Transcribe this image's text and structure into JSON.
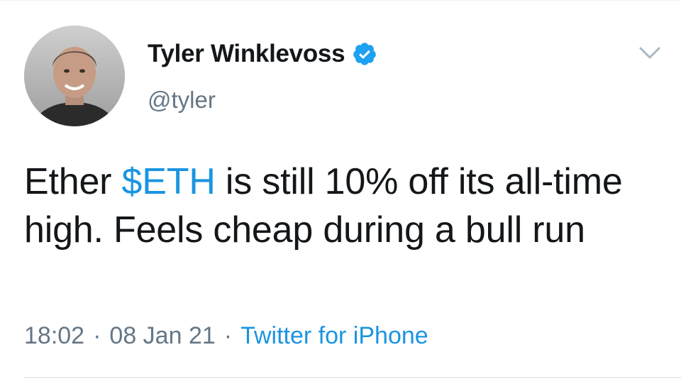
{
  "author": {
    "display_name": "Tyler Winklevoss",
    "handle": "@tyler",
    "verified": true,
    "avatar_icon": "profile-photo"
  },
  "tweet": {
    "text_before": "Ether ",
    "cashtag": "$ETH",
    "text_after": " is still 10% off its all-time high. Feels cheap during a bull run",
    "time": "18:02",
    "date": "08 Jan 21",
    "separator": "·",
    "source": "Twitter for iPhone"
  },
  "icons": {
    "verified": "verified-badge-icon",
    "menu": "chevron-down-icon"
  },
  "colors": {
    "link": "#1b95e0",
    "text": "#14171a",
    "muted": "#657786",
    "verified": "#1da1f2"
  }
}
